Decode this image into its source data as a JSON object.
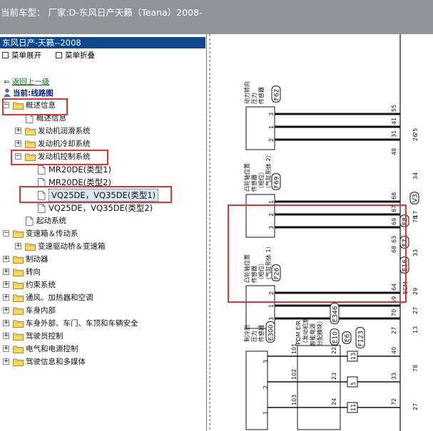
{
  "title_bar": {
    "text": "当前车型：  厂家:D-东风日产天籁（Teana）2008-"
  },
  "panel": {
    "header": "东风日产-天籁--2008",
    "expand_all": "菜单展开",
    "collapse_all": "菜单折叠"
  },
  "nav": {
    "back": "返回上一级",
    "current": "当前:线路图"
  },
  "tree": [
    {
      "label": "概述信息",
      "indent": 0,
      "expander": "minus",
      "icon": "folder"
    },
    {
      "label": "概述信息",
      "indent": 1,
      "expander": "none",
      "icon": "doc"
    },
    {
      "label": "发动机润滑系统",
      "indent": 1,
      "expander": "plus",
      "icon": "folder"
    },
    {
      "label": "发动机冷却系统",
      "indent": 1,
      "expander": "plus",
      "icon": "folder"
    },
    {
      "label": "发动机控制系统",
      "indent": 1,
      "expander": "minus",
      "icon": "folder"
    },
    {
      "label": "MR20DE(类型1)",
      "indent": 2,
      "expander": "none",
      "icon": "doc"
    },
    {
      "label": "MR20DE(类型2)",
      "indent": 2,
      "expander": "none",
      "icon": "doc"
    },
    {
      "label": "VQ25DE，VQ35DE(类型1)",
      "indent": 2,
      "expander": "none",
      "icon": "doc",
      "selected": true
    },
    {
      "label": "VQ25DE，VQ35DE(类型2)",
      "indent": 2,
      "expander": "none",
      "icon": "doc"
    },
    {
      "label": "起动系统",
      "indent": 1,
      "expander": "none",
      "icon": "doc"
    },
    {
      "label": "变速箱＆传动系",
      "indent": 0,
      "expander": "minus",
      "icon": "folder"
    },
    {
      "label": "变速驱动桥＆变速箱",
      "indent": 1,
      "expander": "plus",
      "icon": "folder"
    },
    {
      "label": "制动器",
      "indent": 0,
      "expander": "plus",
      "icon": "folder"
    },
    {
      "label": "转向",
      "indent": 0,
      "expander": "plus",
      "icon": "folder"
    },
    {
      "label": "约束系统",
      "indent": 0,
      "expander": "plus",
      "icon": "folder"
    },
    {
      "label": "通风、加热器和空调",
      "indent": 0,
      "expander": "plus",
      "icon": "folder"
    },
    {
      "label": "车身内部",
      "indent": 0,
      "expander": "plus",
      "icon": "folder"
    },
    {
      "label": "车身外部、车门、车顶和车辆安全",
      "indent": 0,
      "expander": "plus",
      "icon": "folder"
    },
    {
      "label": "驾驶员控制",
      "indent": 0,
      "expander": "plus",
      "icon": "folder"
    },
    {
      "label": "电气和电源控制",
      "indent": 0,
      "expander": "plus",
      "icon": "folder"
    },
    {
      "label": "驾驶信息和多媒体",
      "indent": 0,
      "expander": "plus",
      "icon": "folder"
    }
  ],
  "diagram": {
    "sensors": [
      {
        "lines": [
          "动力转向",
          "压力",
          "传感器"
        ],
        "code": "F62",
        "pins": [
          "3",
          "1",
          "2"
        ],
        "wires": [
          "55",
          "41",
          "31"
        ],
        "ecm": [
          "48"
        ],
        "right": "75"
      },
      {
        "lines": [
          "凸轮轴位置",
          "传感器",
          "（相位）",
          "（气缸侧体 2）"
        ],
        "code": "F69",
        "pins": [
          "1",
          "2",
          "3"
        ],
        "wires": [
          "68",
          "67",
          "69"
        ],
        "ecm": [
          "63",
          "68"
        ],
        "right": "78"
      },
      {
        "lines": [
          "凸轮轴位置",
          "传感器",
          "（相位）",
          "（气缸侧体 1）"
        ],
        "code": "F26",
        "pins": [
          "2",
          "1",
          "3"
        ],
        "wires": [
          "64",
          "59",
          "70"
        ],
        "ecm": [
          "27"
        ],
        "right": "27"
      }
    ],
    "connectors": [
      "V3",
      "F8",
      "F7",
      "E16",
      "E6",
      "F123",
      "E10",
      "E346",
      "E300"
    ],
    "ecm_label": "ECM",
    "ipdm": {
      "lines": [
        "IPDM E/R",
        "（发动机室",
        "智能电源",
        "分配模块）"
      ],
      "pins": [
        "101",
        "102",
        "103"
      ],
      "wires": [
        "22",
        "23",
        "24"
      ]
    },
    "refrig": {
      "lines": [
        "制冷剂",
        "压力",
        "传感器"
      ],
      "pins": [
        "3",
        "2",
        "1"
      ]
    },
    "bottom_wires": [
      "40",
      "33",
      "72"
    ],
    "fuses": [
      "13",
      "5",
      "11"
    ],
    "right_numbers": [
      "26",
      "34",
      "17",
      "33",
      "29",
      "13",
      "78",
      "27"
    ]
  }
}
